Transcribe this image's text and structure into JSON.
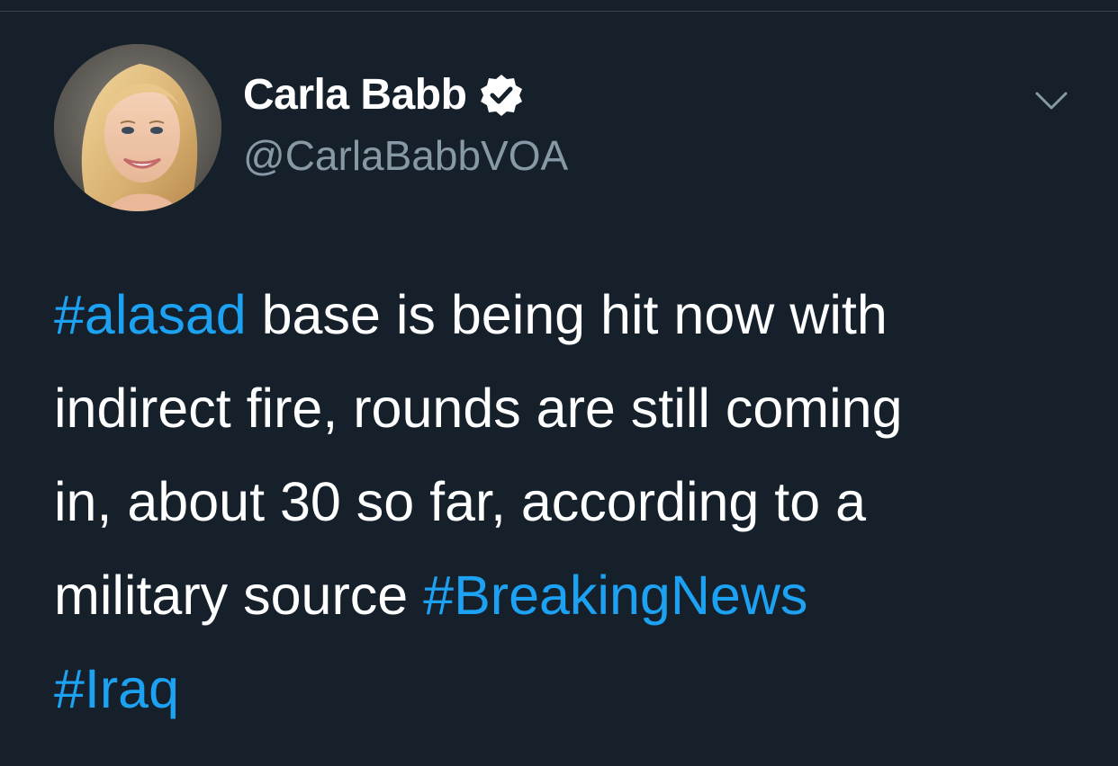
{
  "author": {
    "display_name": "Carla Babb",
    "handle": "@CarlaBabbVOA",
    "verified": true
  },
  "tweet": {
    "line1": {
      "hashtag": "#alasad",
      "text": " base is being hit now with"
    },
    "line2": {
      "text": "indirect fire, rounds are still coming"
    },
    "line3": {
      "text": "in, about 30 so far, according to a"
    },
    "line4": {
      "text": "military source ",
      "hashtag": "#BreakingNews"
    },
    "line5": {
      "hashtag": "#Iraq"
    }
  },
  "icons": {
    "verified": "verified-badge-icon",
    "menu": "chevron-down-icon"
  },
  "colors": {
    "background": "#15202b",
    "text": "#ffffff",
    "secondary_text": "#8899a6",
    "link": "#1da1f2"
  }
}
